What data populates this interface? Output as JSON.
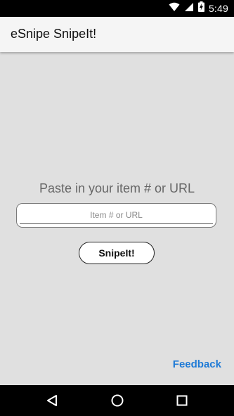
{
  "status_bar": {
    "time": "5:49",
    "icons": [
      "wifi-icon",
      "signal-icon",
      "battery-charging-icon"
    ]
  },
  "app_bar": {
    "title": "eSnipe SnipeIt!"
  },
  "main": {
    "prompt": "Paste in your item # or URL",
    "input": {
      "value": "",
      "placeholder": "Item # or URL"
    },
    "snipe_button_label": "SnipeIt!",
    "feedback_link": "Feedback"
  },
  "nav_bar": {
    "buttons": [
      "back-icon",
      "home-icon",
      "recents-icon"
    ]
  },
  "colors": {
    "background": "#e0e0e0",
    "app_bar": "#f5f5f5",
    "accent_link": "#1e7ad6",
    "system_bars": "#000000"
  }
}
